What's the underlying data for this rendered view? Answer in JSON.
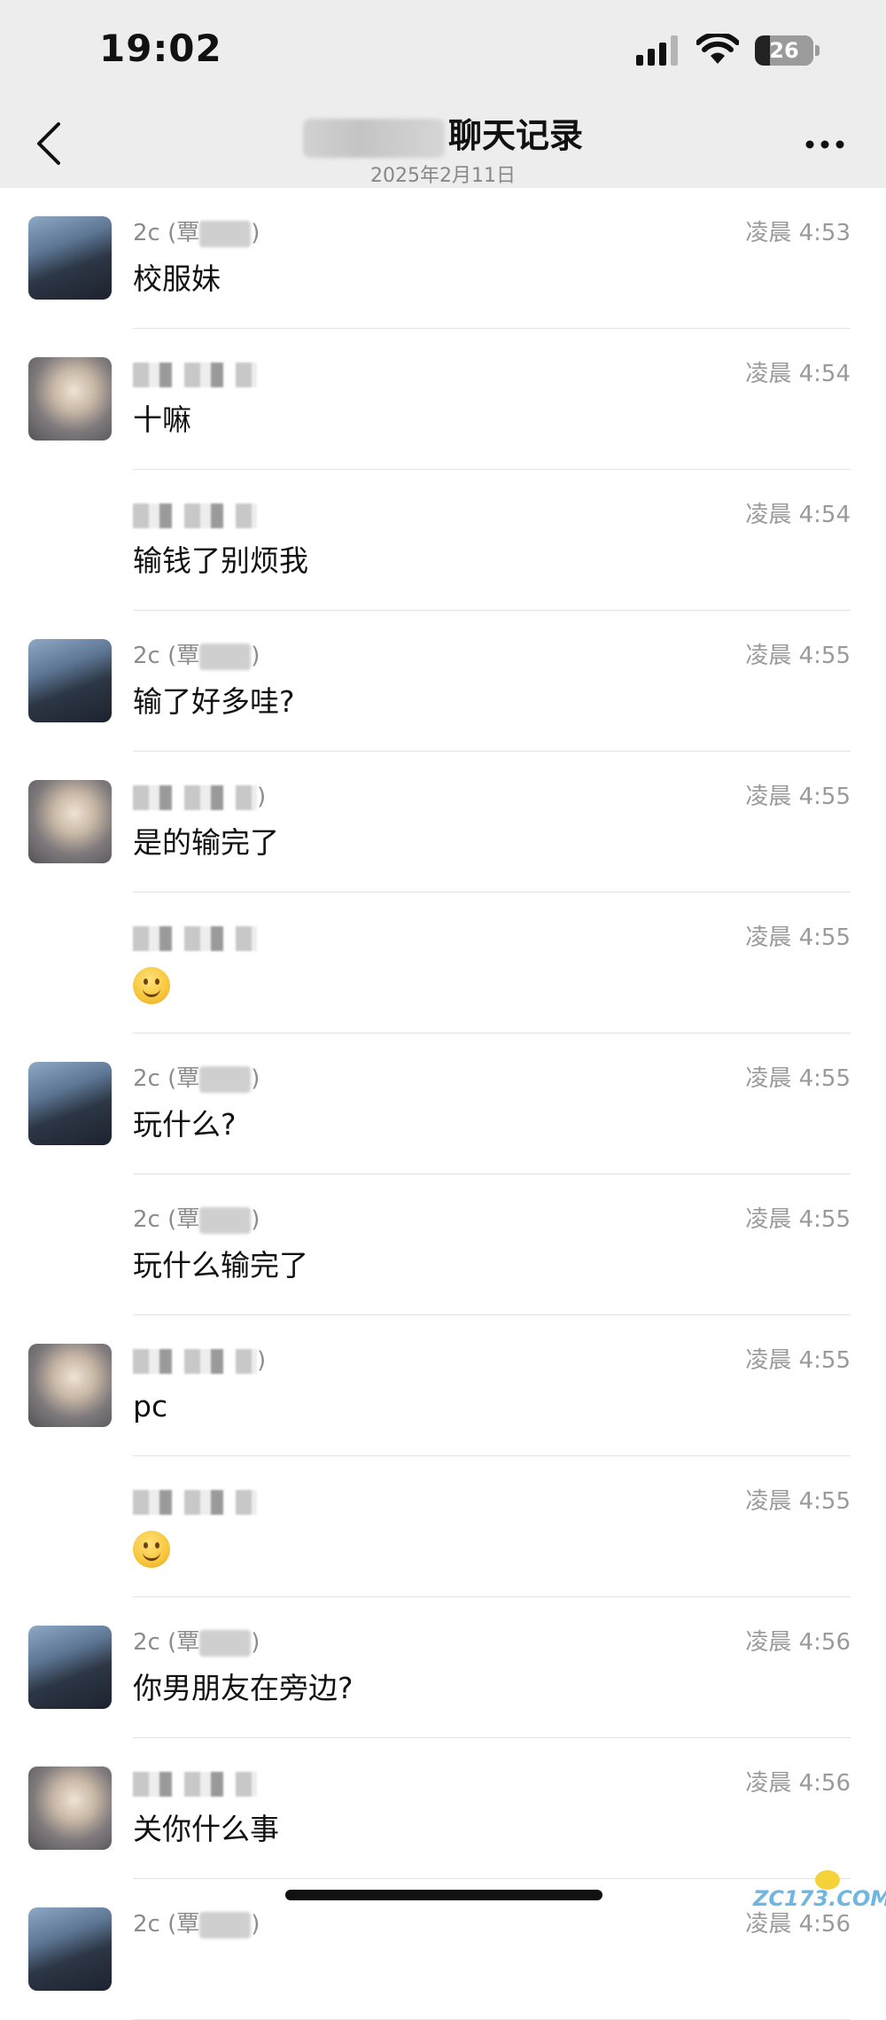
{
  "status_bar": {
    "time": "19:02",
    "battery": "26",
    "icons": [
      "signal-icon",
      "wifi-icon",
      "battery-icon"
    ]
  },
  "nav": {
    "title": "聊天记录",
    "subtitle": "2025年2月11日",
    "icons": [
      "chevron-left-icon",
      "more-icon"
    ]
  },
  "messages": [
    {
      "sender": "2c (覃",
      "sender_suffix": ")",
      "time": "凌晨 4:53",
      "text": "校服妹",
      "avatar": "a",
      "emoji": false
    },
    {
      "sender": "",
      "sender_suffix": "",
      "time": "凌晨 4:54",
      "text": "十嘛",
      "avatar": "b",
      "emoji": false
    },
    {
      "sender": "",
      "sender_suffix": "",
      "time": "凌晨 4:54",
      "text": "输钱了别烦我",
      "avatar": "",
      "emoji": false
    },
    {
      "sender": "2c (覃",
      "sender_suffix": ")",
      "time": "凌晨 4:55",
      "text": "输了好多哇?",
      "avatar": "a",
      "emoji": false
    },
    {
      "sender": "",
      "sender_suffix": ")",
      "time": "凌晨 4:55",
      "text": "是的输完了",
      "avatar": "b",
      "emoji": false
    },
    {
      "sender": "",
      "sender_suffix": "",
      "time": "凌晨 4:55",
      "text": "",
      "avatar": "",
      "emoji": true
    },
    {
      "sender": "2c (覃",
      "sender_suffix": ")",
      "time": "凌晨 4:55",
      "text": "玩什么?",
      "avatar": "a",
      "emoji": false
    },
    {
      "sender": "2c (覃",
      "sender_suffix": ")",
      "time": "凌晨 4:55",
      "text": "玩什么输完了",
      "avatar": "",
      "emoji": false
    },
    {
      "sender": "",
      "sender_suffix": ")",
      "time": "凌晨 4:55",
      "text": "pc",
      "avatar": "b",
      "emoji": false
    },
    {
      "sender": "",
      "sender_suffix": "",
      "time": "凌晨 4:55",
      "text": "",
      "avatar": "",
      "emoji": true
    },
    {
      "sender": "2c (覃",
      "sender_suffix": ")",
      "time": "凌晨 4:56",
      "text": "你男朋友在旁边?",
      "avatar": "a",
      "emoji": false
    },
    {
      "sender": "",
      "sender_suffix": "",
      "time": "凌晨 4:56",
      "text": "关你什么事",
      "avatar": "b",
      "emoji": false
    },
    {
      "sender": "2c (覃",
      "sender_suffix": ")",
      "time": "凌晨 4:56",
      "text": "",
      "avatar": "a",
      "emoji": false
    }
  ],
  "watermark": "ZC173.COM",
  "colors": {
    "header_bg": "#ededed",
    "timestamp": "#9a9a9a",
    "text": "#111111"
  }
}
